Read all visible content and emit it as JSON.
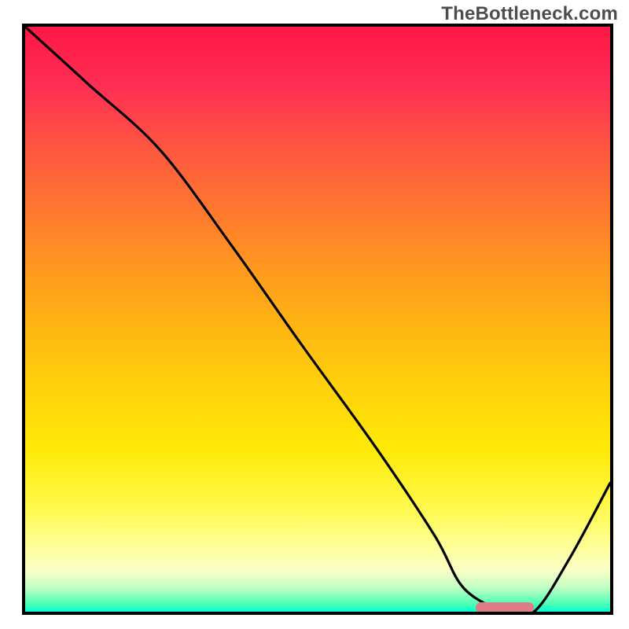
{
  "watermark": "TheBottleneck.com",
  "chart_data": {
    "type": "line",
    "title": "",
    "xlabel": "",
    "ylabel": "",
    "xlim": [
      0,
      100
    ],
    "ylim": [
      0,
      100
    ],
    "grid": false,
    "legend": false,
    "series": [
      {
        "name": "bottleneck-curve",
        "x": [
          0,
          11,
          23,
          35,
          47,
          60,
          70,
          75,
          82,
          87,
          93,
          100
        ],
        "values": [
          100,
          90,
          79,
          63,
          46,
          28,
          13,
          4,
          0,
          0,
          9,
          22
        ]
      }
    ],
    "optimal_marker": {
      "x_start": 77,
      "x_end": 87,
      "y": 0
    },
    "gradient_stops": [
      {
        "pct": 0,
        "color": "#ff1744"
      },
      {
        "pct": 50,
        "color": "#ffb400"
      },
      {
        "pct": 85,
        "color": "#fff200"
      },
      {
        "pct": 100,
        "color": "#00ffde"
      }
    ]
  }
}
